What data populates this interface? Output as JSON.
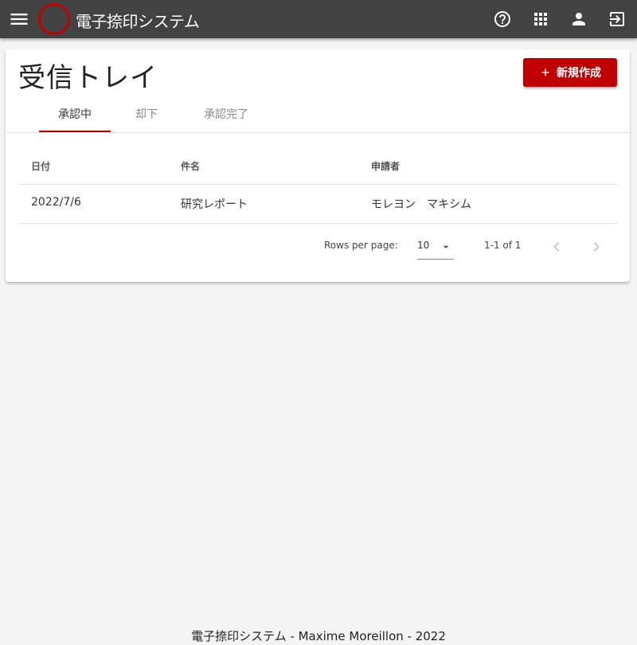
{
  "appbar": {
    "title": "電子捺印システム",
    "icons": [
      "menu-icon",
      "logo-ring",
      "help-icon",
      "apps-icon",
      "account-icon",
      "logout-icon"
    ]
  },
  "page": {
    "title": "受信トレイ",
    "new_button_label": "新規作成"
  },
  "tabs": [
    {
      "label": "承認中",
      "active": true
    },
    {
      "label": "却下",
      "active": false
    },
    {
      "label": "承認完了",
      "active": false
    }
  ],
  "table": {
    "headers": [
      "日付",
      "件名",
      "申請者"
    ],
    "rows": [
      [
        "2022/7/6",
        "研究レポート",
        "モレヨン　マキシム"
      ]
    ]
  },
  "pagination": {
    "rows_per_page_label": "Rows per page:",
    "rows_per_page_value": "10",
    "range_text": "1-1 of 1"
  },
  "footer": {
    "text": "電子捺印システム - Maxime Moreillon - 2022"
  },
  "colors": {
    "appbar": "#424242",
    "accent": "#c00000",
    "background": "#f4f4f4"
  }
}
